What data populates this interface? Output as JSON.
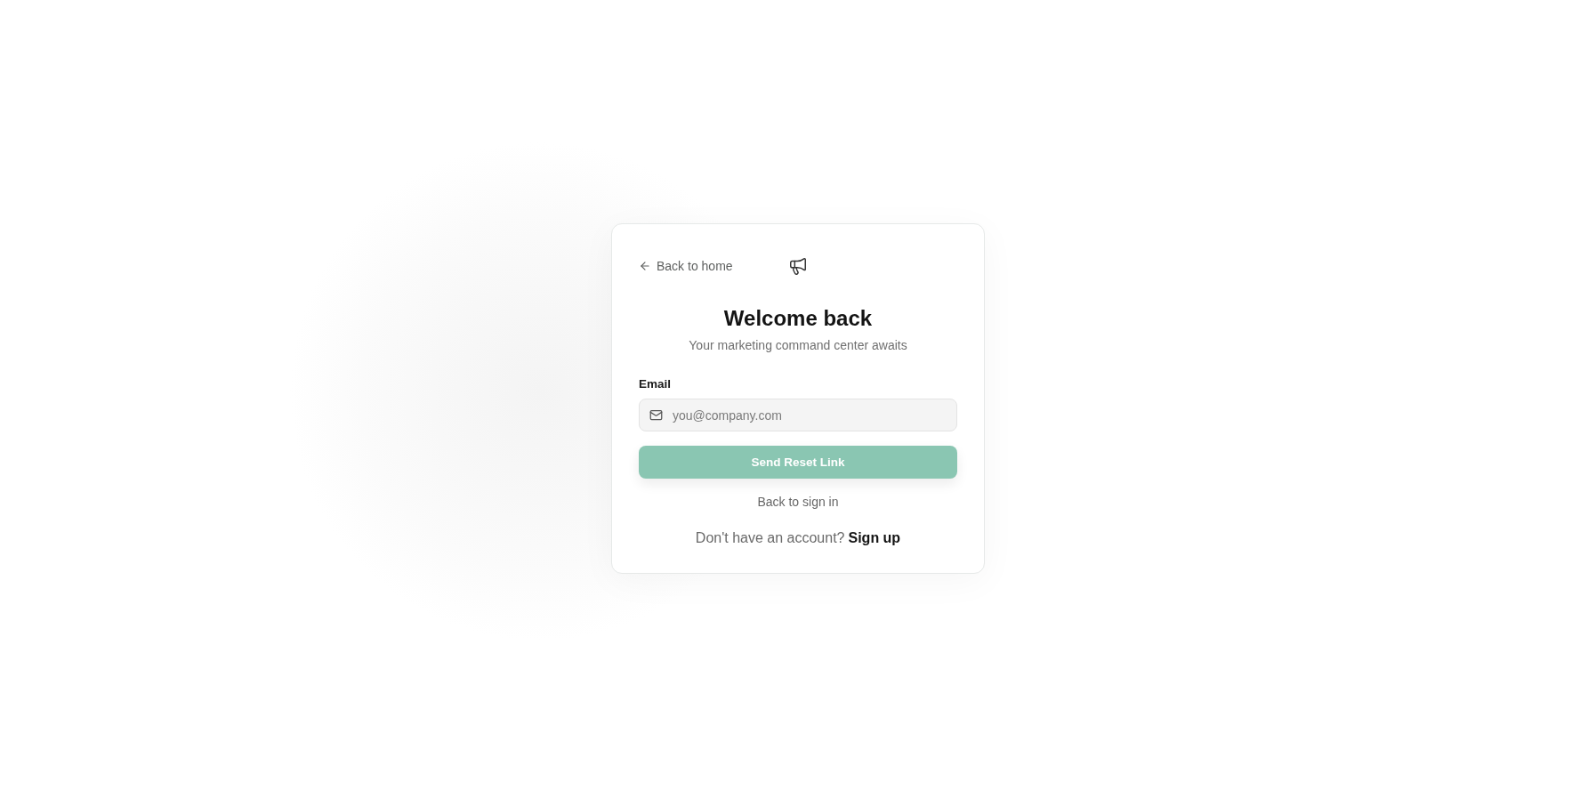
{
  "back_link": {
    "label": "Back to home"
  },
  "heading": "Welcome back",
  "subtitle": "Your marketing command center awaits",
  "email": {
    "label": "Email",
    "placeholder": "you@company.com"
  },
  "submit": {
    "label": "Send Reset Link",
    "disabled": true
  },
  "back_to_sign_in": "Back to sign in",
  "signup": {
    "prompt": "Don't have an account?",
    "link": "Sign up"
  }
}
